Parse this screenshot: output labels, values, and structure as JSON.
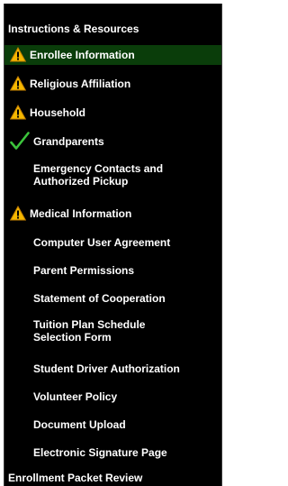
{
  "nav": {
    "items": [
      {
        "label": "Instructions & Resources",
        "status": "none",
        "level": 0,
        "active": false
      },
      {
        "label": "Enrollee Information",
        "status": "warning",
        "level": 1,
        "active": true
      },
      {
        "label": "Religious Affiliation",
        "status": "warning",
        "level": 1,
        "active": false
      },
      {
        "label": "Household",
        "status": "warning",
        "level": 1,
        "active": false
      },
      {
        "label": "Grandparents",
        "status": "complete",
        "level": 1,
        "active": false
      },
      {
        "label": "Emergency Contacts and Authorized Pickup",
        "status": "none",
        "level": 1,
        "active": false
      },
      {
        "label": "Medical Information",
        "status": "warning",
        "level": 1,
        "active": false
      },
      {
        "label": "Computer User Agreement",
        "status": "none",
        "level": 1,
        "active": false
      },
      {
        "label": "Parent Permissions",
        "status": "none",
        "level": 1,
        "active": false
      },
      {
        "label": "Statement of Cooperation",
        "status": "none",
        "level": 1,
        "active": false
      },
      {
        "label": "Tuition Plan Schedule Selection Form",
        "status": "none",
        "level": 1,
        "active": false
      },
      {
        "label": "Student Driver Authorization",
        "status": "none",
        "level": 1,
        "active": false
      },
      {
        "label": "Volunteer Policy",
        "status": "none",
        "level": 1,
        "active": false
      },
      {
        "label": "Document Upload",
        "status": "none",
        "level": 1,
        "active": false
      },
      {
        "label": "Electronic Signature Page",
        "status": "none",
        "level": 1,
        "active": false
      },
      {
        "label": "Enrollment Packet Review",
        "status": "none",
        "level": 0,
        "active": false
      }
    ]
  },
  "colors": {
    "background": "#000000",
    "text": "#ffffff",
    "active_background": "#0a3d0a",
    "warning_fill": "#f5b800",
    "complete_check": "#3cc43c"
  },
  "icons": {
    "warning": "warning-triangle-icon",
    "complete": "checkmark-icon"
  }
}
